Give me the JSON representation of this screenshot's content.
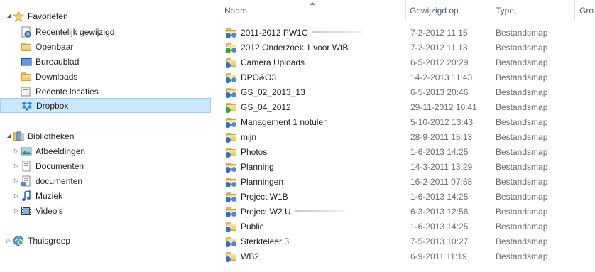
{
  "nav": {
    "favorites_label": "Favorieten",
    "favorites": [
      {
        "label": "Recentelijk gewijzigd",
        "icon": "recent-changes-icon"
      },
      {
        "label": "Openbaar",
        "icon": "folder-icon"
      },
      {
        "label": "Bureaublad",
        "icon": "desktop-icon"
      },
      {
        "label": "Downloads",
        "icon": "downloads-icon"
      },
      {
        "label": "Recente locaties",
        "icon": "recent-locations-icon"
      },
      {
        "label": "Dropbox",
        "icon": "dropbox-icon",
        "selected": true
      }
    ],
    "libraries_label": "Bibliotheken",
    "libraries": [
      {
        "label": "Afbeeldingen",
        "icon": "pictures-icon"
      },
      {
        "label": "Documenten",
        "icon": "documents-icon"
      },
      {
        "label": "documenten",
        "icon": "documents-library-icon"
      },
      {
        "label": "Muziek",
        "icon": "music-icon"
      },
      {
        "label": "Video's",
        "icon": "videos-icon"
      }
    ],
    "homegroup_label": "Thuisgroep"
  },
  "columns": {
    "name": "Naam",
    "modified": "Gewijzigd op",
    "type": "Type",
    "size": "Gro"
  },
  "files": [
    {
      "name": "2011-2012 PW1C",
      "date": "7-2-2012 11:15",
      "type": "Bestandsmap",
      "badge": "sync",
      "shared": true,
      "redacted": true
    },
    {
      "name": "2012 Onderzoek 1 voor WtB",
      "date": "7-2-2012 11:13",
      "type": "Bestandsmap",
      "badge": "ok",
      "shared": true
    },
    {
      "name": "Camera Uploads",
      "date": "6-5-2012 20:29",
      "type": "Bestandsmap",
      "badge": "sync",
      "shared": false
    },
    {
      "name": "DPO&O3",
      "date": "14-2-2013 11:43",
      "type": "Bestandsmap",
      "badge": "sync",
      "shared": true
    },
    {
      "name": "GS_02_2013_13",
      "date": "6-5-2013 20:46",
      "type": "Bestandsmap",
      "badge": "sync",
      "shared": true
    },
    {
      "name": "GS_04_2012",
      "date": "29-11-2012 10:41",
      "type": "Bestandsmap",
      "badge": "ok",
      "shared": false
    },
    {
      "name": "Management 1 notulen",
      "date": "5-10-2012 13:43",
      "type": "Bestandsmap",
      "badge": "sync",
      "shared": true
    },
    {
      "name": "mijn",
      "date": "28-9-2011 15:13",
      "type": "Bestandsmap",
      "badge": "sync",
      "shared": false
    },
    {
      "name": "Photos",
      "date": "1-6-2013 14:25",
      "type": "Bestandsmap",
      "badge": "sync",
      "shared": false
    },
    {
      "name": "Planning",
      "date": "14-3-2011 13:29",
      "type": "Bestandsmap",
      "badge": "sync",
      "shared": true
    },
    {
      "name": "Planningen",
      "date": "16-2-2011 07:58",
      "type": "Bestandsmap",
      "badge": "sync",
      "shared": true
    },
    {
      "name": "Project W1B",
      "date": "1-6-2013 14:25",
      "type": "Bestandsmap",
      "badge": "sync",
      "shared": true
    },
    {
      "name": "Project W2 U",
      "date": "6-3-2013 12:56",
      "type": "Bestandsmap",
      "badge": "sync",
      "shared": true,
      "redacted": true
    },
    {
      "name": "Public",
      "date": "1-6-2013 14:25",
      "type": "Bestandsmap",
      "badge": "sync",
      "shared": false
    },
    {
      "name": "Sterkteleer 3",
      "date": "7-5-2013 10:27",
      "type": "Bestandsmap",
      "badge": "sync",
      "shared": true
    },
    {
      "name": "WB2",
      "date": "6-9-2011 11:19",
      "type": "Bestandsmap",
      "badge": "sync",
      "shared": false
    }
  ],
  "colors": {
    "selection": "#cce8ff",
    "selection_border": "#99d1ff",
    "header_text": "#4c607a",
    "meta_text": "#6d6d6d"
  }
}
